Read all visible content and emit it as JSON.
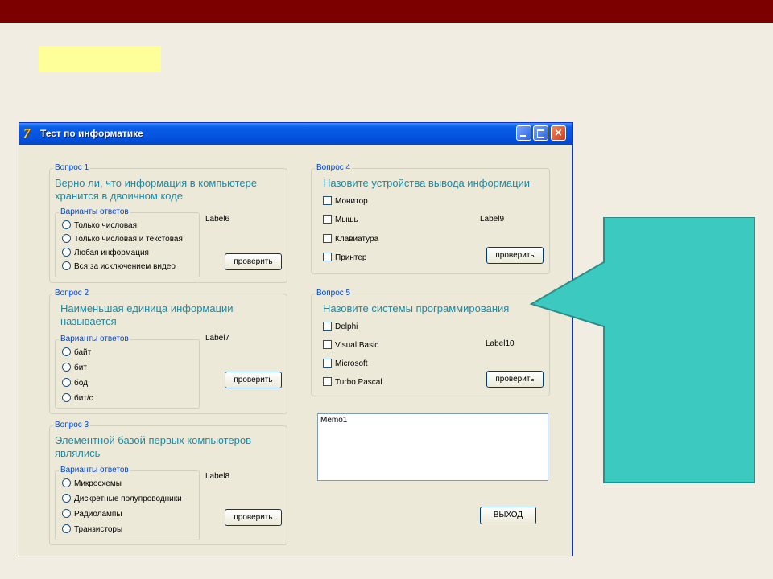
{
  "window": {
    "title": "Тест по информатике",
    "app_icon": "7"
  },
  "q1": {
    "group_title": "Вопрос 1",
    "question": [
      "Верно ли, что информация в компьютере",
      "хранится в двоичном коде"
    ],
    "answers_title": "Варианты ответов",
    "options": [
      "Только числовая",
      "Только числовая и текстовая",
      "Любая информация",
      "Вся за исключением видео"
    ],
    "label": "Label6",
    "button": "проверить"
  },
  "q2": {
    "group_title": "Вопрос 2",
    "question": [
      "Наименьшая единица информации",
      "называется"
    ],
    "answers_title": "Варианты ответов",
    "options": [
      "байт",
      "бит",
      "бод",
      "бит/с"
    ],
    "label": "Label7",
    "button": "проверить"
  },
  "q3": {
    "group_title": "Вопрос 3",
    "question": [
      "Элементной базой первых компьютеров",
      "являлись"
    ],
    "answers_title": "Варианты ответов",
    "options": [
      "Микросхемы",
      "Дискретные полупроводники",
      "Радиолампы",
      "Транзисторы"
    ],
    "label": "Label8",
    "button": "проверить"
  },
  "q4": {
    "group_title": "Вопрос 4",
    "question": "Назовите устройства вывода информации",
    "options": [
      "Монитор",
      "Мышь",
      "Клавиатура",
      "Принтер"
    ],
    "label": "Label9",
    "button": "проверить"
  },
  "q5": {
    "group_title": "Вопрос 5",
    "question": "Назовите системы программирования",
    "options": [
      "Delphi",
      "Visual Basic",
      "Microsoft",
      "Turbo Pascal"
    ],
    "label": "Label10",
    "button": "проверить"
  },
  "memo": "Memo1",
  "exit_button": "ВЫХОД",
  "colors": {
    "top_bar": "#7d0000",
    "highlight": "#ffff99",
    "callout": "#3cc9c0",
    "question_text": "#1c8aa6",
    "group_title": "#0046d5"
  },
  "icons": [
    "app-icon",
    "minimize-icon",
    "maximize-icon",
    "close-icon",
    "callout-shape"
  ]
}
